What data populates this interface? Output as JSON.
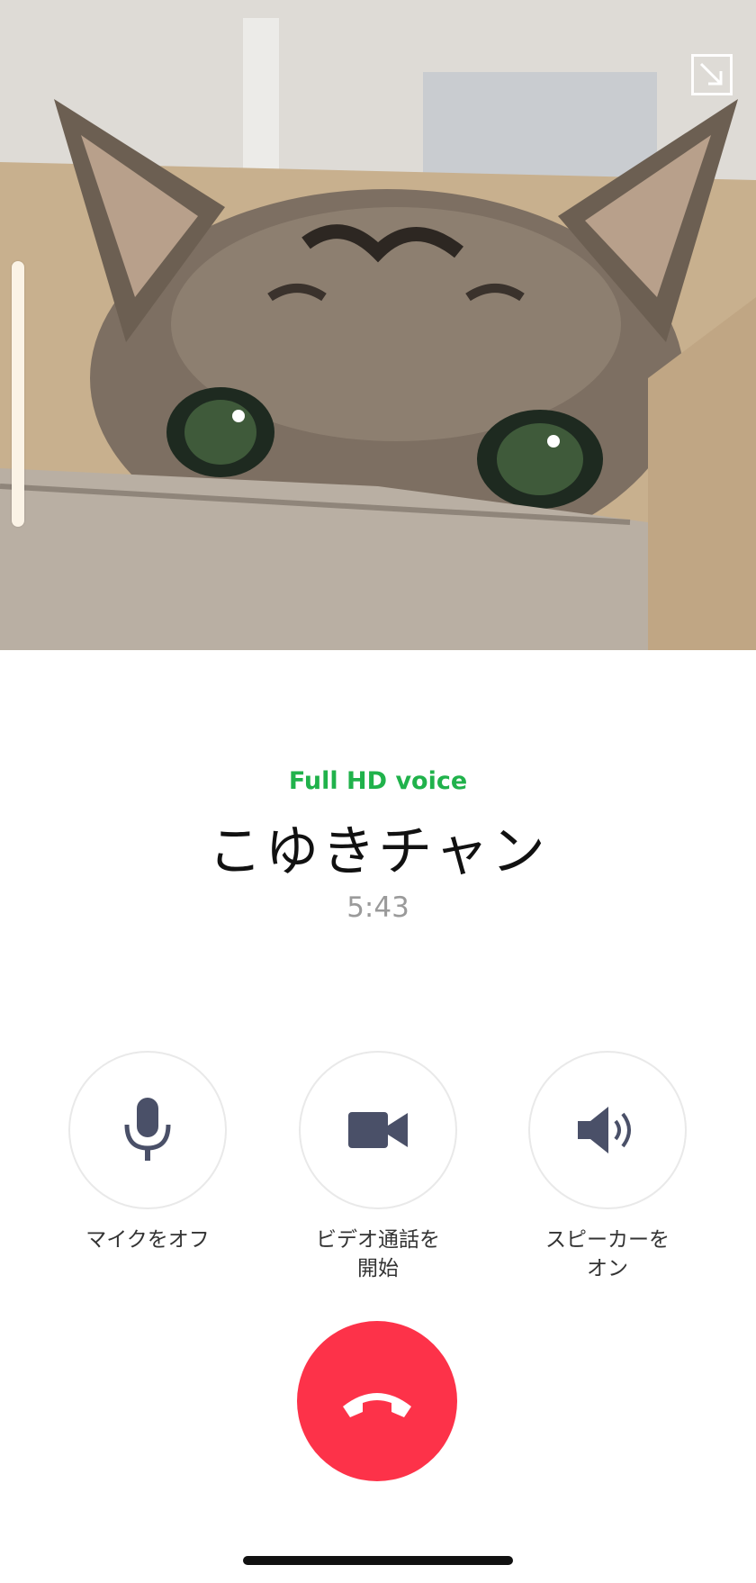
{
  "call": {
    "quality_label": "Full HD voice",
    "contact_name": "こゆきチャン",
    "duration": "5:43"
  },
  "controls": [
    {
      "label": "マイクをオフ",
      "icon": "microphone-icon"
    },
    {
      "label": "ビデオ通話を\n開始",
      "icon": "video-camera-icon"
    },
    {
      "label": "スピーカーを\nオン",
      "icon": "speaker-icon"
    }
  ],
  "end_call": {
    "icon": "hang-up-phone-icon"
  },
  "colors": {
    "accent_green": "#20b24b",
    "end_call_red": "#fd3249",
    "icon_color": "#4a5068"
  }
}
